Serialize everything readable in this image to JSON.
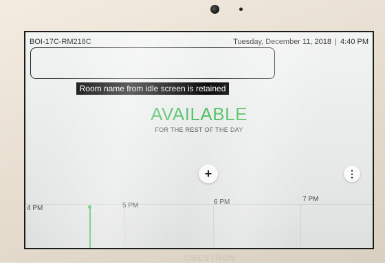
{
  "header": {
    "room_id": "BOI-17C-RM218C",
    "date": "Tuesday, December 11, 2018",
    "separator": "|",
    "time": "4:40 PM"
  },
  "annotation": {
    "callout_text": "Room name from idle screen is retained"
  },
  "status": {
    "label": "AVAILABLE",
    "sublabel": "FOR THE REST OF THE DAY",
    "color": "#4fbf64"
  },
  "actions": {
    "add_symbol": "+",
    "more_symbol": "⋮"
  },
  "timeline": {
    "labels": [
      "4 PM",
      "5 PM",
      "6 PM",
      "7 PM"
    ]
  },
  "device": {
    "brand": "CRESTRON"
  }
}
